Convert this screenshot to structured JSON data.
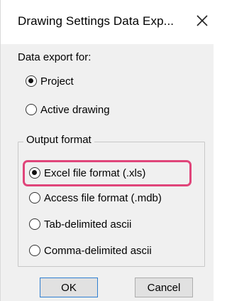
{
  "dialog": {
    "title": "Drawing Settings Data Exp...",
    "close_icon": "close-icon"
  },
  "data_export": {
    "label": "Data export for:",
    "options": [
      {
        "label": "Project",
        "checked": true
      },
      {
        "label": "Active drawing",
        "checked": false
      }
    ]
  },
  "output_format": {
    "caption": "Output format",
    "options": [
      {
        "label": "Excel file format (.xls)",
        "checked": true,
        "highlighted": true
      },
      {
        "label": "Access file format (.mdb)",
        "checked": false
      },
      {
        "label": "Tab-delimited ascii",
        "checked": false
      },
      {
        "label": "Comma-delimited ascii",
        "checked": false
      }
    ],
    "highlight_color": "#e0457a"
  },
  "buttons": {
    "ok_label": "OK",
    "cancel_label": "Cancel"
  }
}
